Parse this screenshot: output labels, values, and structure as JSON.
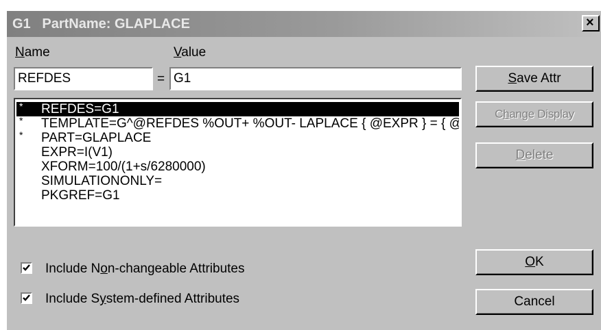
{
  "window": {
    "title": "G1   PartName: GLAPLACE",
    "close_glyph": "✕"
  },
  "labels": {
    "name_pre": "",
    "name_u": "N",
    "name_post": "ame",
    "value_u": "V",
    "value_post": "alue",
    "equals": "="
  },
  "fields": {
    "name_value": "REFDES",
    "value_value": "G1"
  },
  "attributes": [
    {
      "star": "*",
      "text": "REFDES=G1",
      "selected": true
    },
    {
      "star": "*",
      "text": "TEMPLATE=G^@REFDES %OUT+ %OUT- LAPLACE { @EXPR } = { @XFORM }",
      "selected": false
    },
    {
      "star": "*",
      "text": "PART=GLAPLACE",
      "selected": false
    },
    {
      "star": "",
      "text": "EXPR=I(V1)",
      "selected": false
    },
    {
      "star": "",
      "text": "XFORM=100/(1+s/6280000)",
      "selected": false
    },
    {
      "star": "",
      "text": "SIMULATIONONLY=",
      "selected": false
    },
    {
      "star": "",
      "text": "PKGREF=G1",
      "selected": false
    }
  ],
  "buttons": {
    "save_u": "S",
    "save_post": "ave Attr",
    "change_pre": "C",
    "change_u": "h",
    "change_post": "ange Display",
    "delete_u": "D",
    "delete_post": "elete",
    "ok_u": "O",
    "ok_post": "K",
    "cancel": "Cancel"
  },
  "checkboxes": {
    "noncheck_pre": "Include N",
    "noncheck_u": "o",
    "noncheck_post": "n-changeable Attributes",
    "noncheck_checked": true,
    "sys_pre": "Include S",
    "sys_u": "y",
    "sys_post": "stem-defined Attributes",
    "sys_checked": true
  }
}
